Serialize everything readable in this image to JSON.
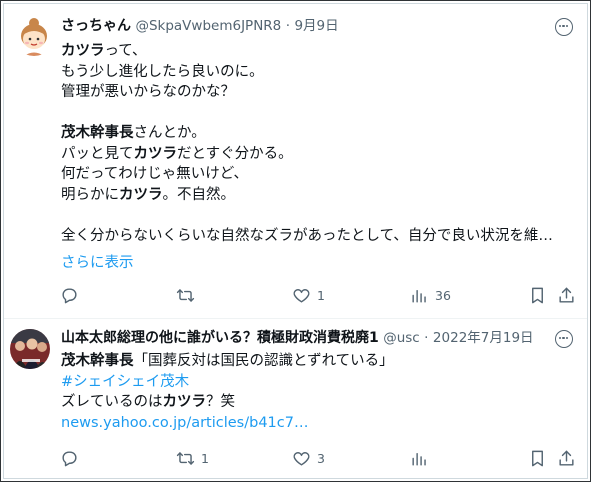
{
  "tweet1": {
    "display_name": "さっちゃん",
    "handle": "@SkpaVwbem6JPNR8",
    "separator": "·",
    "date": "9月9日",
    "lines": [
      [
        {
          "t": "カツラ",
          "b": true
        },
        {
          "t": "って、"
        }
      ],
      [
        {
          "t": "もう少し進化したら良いのに。"
        }
      ],
      [
        {
          "t": "管理が悪いからなのかな？"
        }
      ],
      [],
      [
        {
          "t": "茂木幹事長",
          "b": true
        },
        {
          "t": "さんとか。"
        }
      ],
      [
        {
          "t": "パッと見て"
        },
        {
          "t": "カツラ",
          "b": true
        },
        {
          "t": "だとすぐ分かる。"
        }
      ],
      [
        {
          "t": "何だってわけじゃ無いけど、"
        }
      ],
      [
        {
          "t": "明らかに"
        },
        {
          "t": "カツラ",
          "b": true
        },
        {
          "t": "。不自然。"
        }
      ],
      [],
      [
        {
          "t": "全く分からないくらいな自然なズラがあったとして、自分で良い状況を維…"
        }
      ]
    ],
    "show_more": "さらに表示",
    "actions": {
      "reply": "",
      "retweet": "",
      "like": "1",
      "views": "36"
    }
  },
  "tweet2": {
    "display_name": "山本太郎総理の他に誰がいる？積極財政消費税廃",
    "name_badge": "1",
    "handle": "@usc",
    "separator": "·",
    "date": "2022年7月19日",
    "lines": [
      [
        {
          "t": "茂木幹事長",
          "b": true
        },
        {
          "t": "「国葬反対は国民の認識とずれている」"
        }
      ],
      [
        {
          "t": "#シェイシェイ茂木",
          "link": true
        }
      ],
      [
        {
          "t": "ズレているのは"
        },
        {
          "t": "カツラ",
          "b": true
        },
        {
          "t": "？笑"
        }
      ],
      [
        {
          "t": "news.yahoo.co.jp/articles/b41c7…",
          "link": true
        }
      ]
    ],
    "actions": {
      "reply": "",
      "retweet": "1",
      "like": "3",
      "views": ""
    }
  },
  "icons": [
    "reply-icon",
    "retweet-icon",
    "like-icon",
    "views-icon",
    "bookmark-icon",
    "share-icon",
    "more-icon"
  ],
  "colors": {
    "text": "#0f1419",
    "muted": "#536471",
    "link": "#1d9bf0",
    "divider": "#eff3f4"
  }
}
